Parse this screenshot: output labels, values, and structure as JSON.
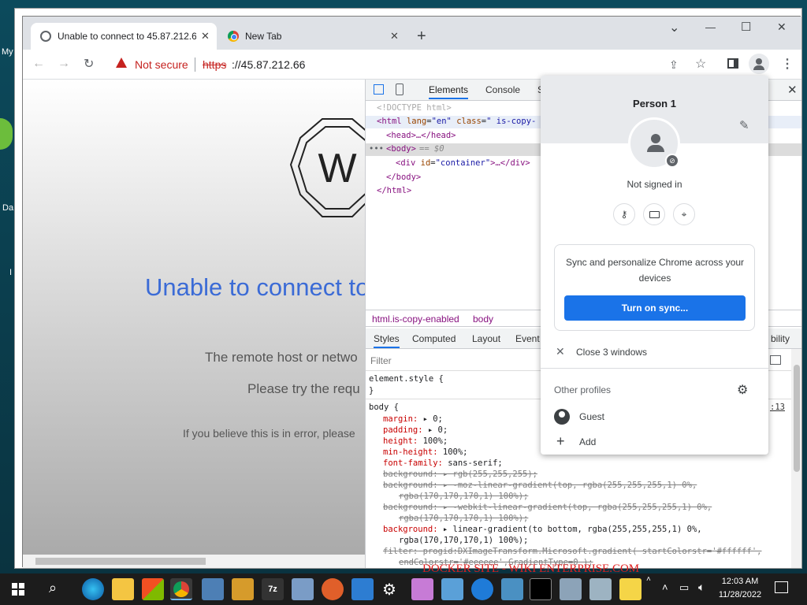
{
  "desktop": {
    "icon_labels": [
      "My",
      "Da",
      "I"
    ]
  },
  "browser": {
    "tabs": [
      {
        "label": "Unable to connect to 45.87.212.6"
      },
      {
        "label": "New Tab"
      }
    ],
    "new_tab_glyph": "+",
    "window_controls": {
      "chevron": "⌄",
      "minimize": "—",
      "maximize": "☐",
      "close": "✕"
    },
    "nav": {
      "back": "←",
      "forward": "→",
      "reload": "↻"
    },
    "security": {
      "label": "Not secure",
      "scheme": "https",
      "url_rest": "://45.87.212.66"
    },
    "toolbar_icons": [
      "share-icon",
      "bookmark-star-icon",
      "side-panel-icon",
      "profile-icon",
      "menu-icon"
    ]
  },
  "page": {
    "heading": "Unable to connect to",
    "line1": "The remote host or netwo",
    "line2": "Please try the requ",
    "line3": "If you believe this is in error, please",
    "logo_letter": "W"
  },
  "devtools": {
    "tabs": [
      "Elements",
      "Console",
      "S"
    ],
    "dom": {
      "doctype": "<!DOCTYPE html>",
      "html_open": {
        "tag": "<html",
        "attr1": "lang",
        "val1": "\"en\"",
        "attr2": "class",
        "val2": "\" is-copy-"
      },
      "head": "<head>…</head>",
      "body_open": "<body>",
      "body_suffix": " == $0",
      "div": {
        "tag": "<div",
        "attr": "id",
        "val": "\"container\"",
        "rest": ">…</div>"
      },
      "body_close": "</body>",
      "html_close": "</html>"
    },
    "breadcrumb": [
      "html.is-copy-enabled",
      "body"
    ],
    "style_tabs": [
      "Styles",
      "Computed",
      "Layout",
      "Event l"
    ],
    "side_tab_fragment": "bility",
    "filter_placeholder": "Filter",
    "element_style": "element.style {",
    "close_brace": "}",
    "body_selector": "body {",
    "source_ref": ":13",
    "rules": [
      {
        "prop": "margin",
        "value": "0;",
        "arrow": true,
        "strike": false
      },
      {
        "prop": "padding",
        "value": "0;",
        "arrow": true,
        "strike": false
      },
      {
        "prop": "height",
        "value": "100%;",
        "arrow": false,
        "strike": false
      },
      {
        "prop": "min-height",
        "value": "100%;",
        "arrow": false,
        "strike": false
      },
      {
        "prop": "font-family",
        "value": "sans-serif;",
        "arrow": false,
        "strike": false
      },
      {
        "prop": "background",
        "value": "rgb(255,255,255);",
        "arrow": true,
        "strike": true
      },
      {
        "prop": "background",
        "value": "-moz-linear-gradient(top, rgba(255,255,255,1) 0%,",
        "arrow": true,
        "strike": true
      },
      {
        "prop": "",
        "value": "rgba(170,170,170,1) 100%);",
        "arrow": false,
        "strike": true,
        "cont": true
      },
      {
        "prop": "background",
        "value": "-webkit-linear-gradient(top, rgba(255,255,255,1) 0%,",
        "arrow": true,
        "strike": true
      },
      {
        "prop": "",
        "value": "rgba(170,170,170,1) 100%);",
        "arrow": false,
        "strike": true,
        "cont": true
      },
      {
        "prop": "background",
        "value": "linear-gradient(to bottom, rgba(255,255,255,1) 0%,",
        "arrow": true,
        "strike": false
      },
      {
        "prop": "",
        "value": "rgba(170,170,170,1) 100%);",
        "arrow": false,
        "strike": false,
        "cont": true
      },
      {
        "prop": "filter",
        "value": "progid:DXImageTransform.Microsoft.gradient( startColorstr='#ffffff',",
        "arrow": false,
        "strike": true
      },
      {
        "prop": "",
        "value": "endColorstr='#eeeeee',GradientType=0 );",
        "arrow": false,
        "strike": true,
        "cont": true
      }
    ]
  },
  "profile_menu": {
    "name": "Person 1",
    "status": "Not signed in",
    "sync_text": "Sync and personalize Chrome across your devices",
    "sync_button": "Turn on sync...",
    "close_windows": "Close 3 windows",
    "other_profiles": "Other profiles",
    "guest": "Guest",
    "add": "Add"
  },
  "taskbar": {
    "time": "12:03 AM",
    "date": "11/28/2022",
    "watermark": "DOCKER SITE - WIKI ENTERPRISE.COM"
  },
  "colors": {
    "accent_blue": "#1a73e8",
    "heading_blue": "#3b6bd6",
    "not_secure_red": "#c5221f"
  }
}
